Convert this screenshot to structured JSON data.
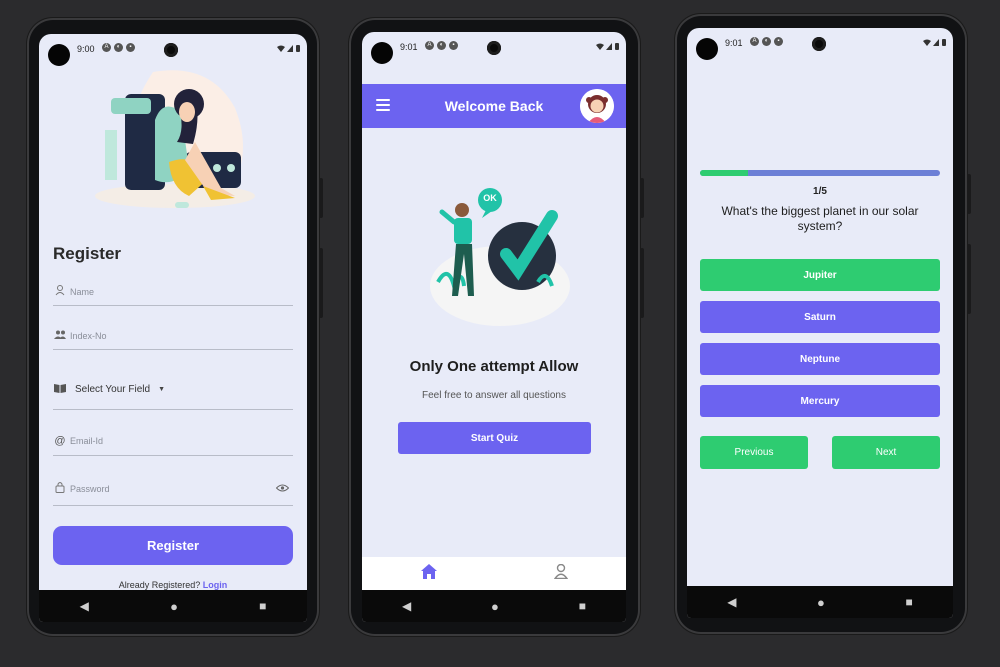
{
  "colors": {
    "primary": "#6c63f0",
    "success": "#2ecc71",
    "background": "#e8ebf8",
    "frame": "#2b2b2d"
  },
  "register_screen": {
    "status_time": "9:00",
    "title": "Register",
    "fields": [
      {
        "icon": "person-icon",
        "placeholder": "Name"
      },
      {
        "icon": "group-icon",
        "placeholder": "Index-No"
      },
      {
        "icon": "book-icon",
        "value": "Select Your Field"
      },
      {
        "icon": "at-icon",
        "placeholder": "Email-Id"
      },
      {
        "icon": "lock-icon",
        "placeholder": "Password"
      }
    ],
    "submit_label": "Register",
    "already_text": "Already Registered?",
    "login_link": "Login"
  },
  "welcome_screen": {
    "status_time": "9:01",
    "header_title": "Welcome Back",
    "speech_bubble": "OK",
    "title": "Only One attempt Allow",
    "subtitle": "Feel free to answer all questions",
    "start_label": "Start Quiz",
    "bottom_nav": [
      {
        "icon": "home-icon",
        "active": true
      },
      {
        "icon": "profile-icon",
        "active": false
      }
    ]
  },
  "quiz_screen": {
    "status_time": "9:01",
    "progress": 0.2,
    "counter": "1/5",
    "question": "What's the biggest planet in our solar system?",
    "options": [
      {
        "label": "Jupiter",
        "state": "correct"
      },
      {
        "label": "Saturn",
        "state": "default"
      },
      {
        "label": "Neptune",
        "state": "default"
      },
      {
        "label": "Mercury",
        "state": "default"
      }
    ],
    "previous_label": "Previous",
    "next_label": "Next"
  }
}
